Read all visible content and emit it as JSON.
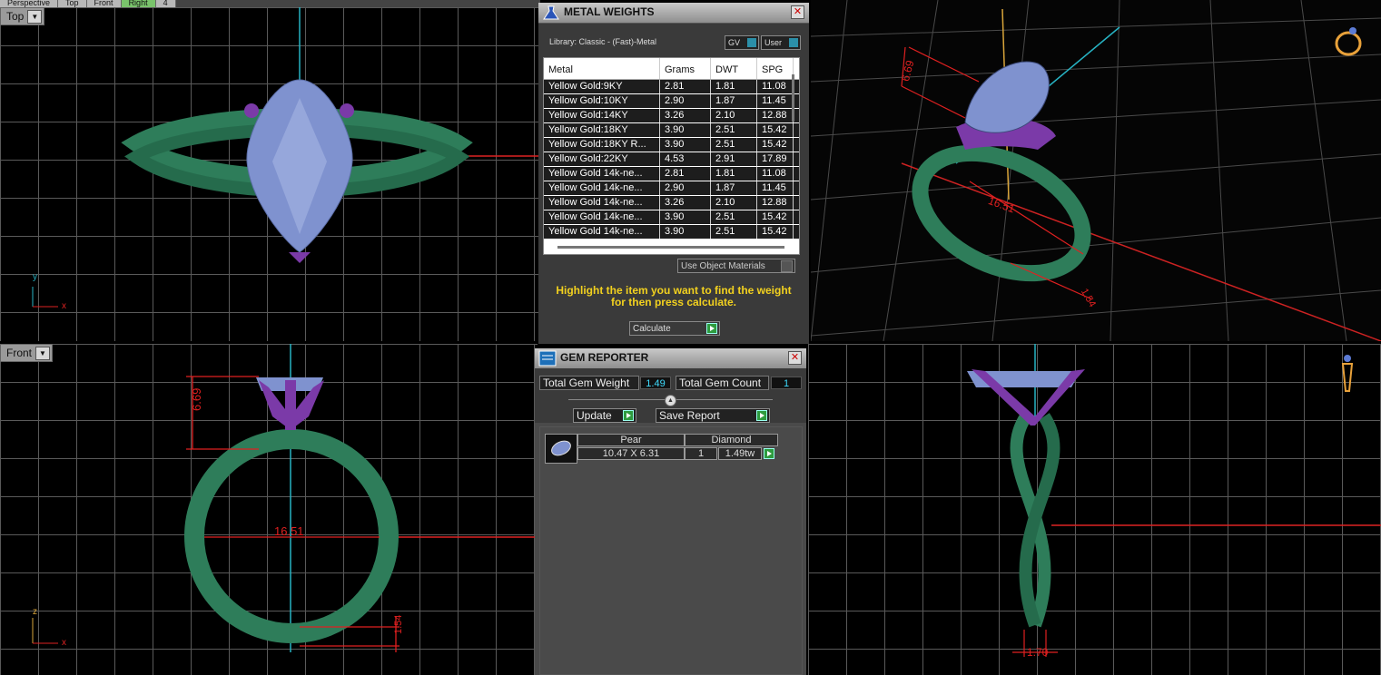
{
  "top_tabs": [
    "Perspective",
    "Top",
    "Front",
    "Right",
    "4"
  ],
  "viewports": {
    "top": {
      "label": "Top",
      "axis1": "y",
      "axis2": "x"
    },
    "front": {
      "label": "Front",
      "axis1": "z",
      "axis2": "x",
      "dim_height": "6.69",
      "dim_width": "16.51",
      "dim_band": "1.54"
    },
    "perspective": {
      "dim_height": "6.69",
      "dim_width": "16.51",
      "dim_band": "1.54"
    },
    "right": {
      "dim_band": "1.70"
    }
  },
  "metal_weights": {
    "title": "METAL WEIGHTS",
    "library_label": "Library: Classic - (Fast)-Metal",
    "gv_label": "GV",
    "user_label": "User",
    "columns": [
      "Metal",
      "Grams",
      "DWT",
      "SPG"
    ],
    "rows": [
      [
        "Yellow Gold:9KY",
        "2.81",
        "1.81",
        "11.08"
      ],
      [
        "Yellow Gold:10KY",
        "2.90",
        "1.87",
        "11.45"
      ],
      [
        "Yellow Gold:14KY",
        "3.26",
        "2.10",
        "12.88"
      ],
      [
        "Yellow Gold:18KY",
        "3.90",
        "2.51",
        "15.42"
      ],
      [
        "Yellow Gold:18KY R...",
        "3.90",
        "2.51",
        "15.42"
      ],
      [
        "Yellow Gold:22KY",
        "4.53",
        "2.91",
        "17.89"
      ],
      [
        "Yellow Gold 14k-ne...",
        "2.81",
        "1.81",
        "11.08"
      ],
      [
        "Yellow Gold 14k-ne...",
        "2.90",
        "1.87",
        "11.45"
      ],
      [
        "Yellow Gold 14k-ne...",
        "3.26",
        "2.10",
        "12.88"
      ],
      [
        "Yellow Gold 14k-ne...",
        "3.90",
        "2.51",
        "15.42"
      ],
      [
        "Yellow Gold 14k-ne...",
        "3.90",
        "2.51",
        "15.42"
      ]
    ],
    "use_object_materials": "Use Object Materials",
    "instruction": "Highlight the item you want to find the weight for then press calculate.",
    "calculate_label": "Calculate"
  },
  "gem_reporter": {
    "title": "GEM REPORTER",
    "total_weight_label": "Total Gem Weight",
    "total_weight_value": "1.49",
    "total_count_label": "Total Gem Count",
    "total_count_value": "1",
    "update_label": "Update",
    "save_report_label": "Save Report",
    "gem": {
      "shape": "Pear",
      "size": "10.47 X 6.31",
      "type": "Diamond",
      "count": "1",
      "weight": "1.49tw"
    }
  },
  "colors": {
    "band": "#2e7d5a",
    "gem": "#7f92cf",
    "prongs": "#7b3aa8",
    "dimension": "#e02020",
    "axis": "#27b3c3",
    "instruction": "#f2d11f"
  }
}
